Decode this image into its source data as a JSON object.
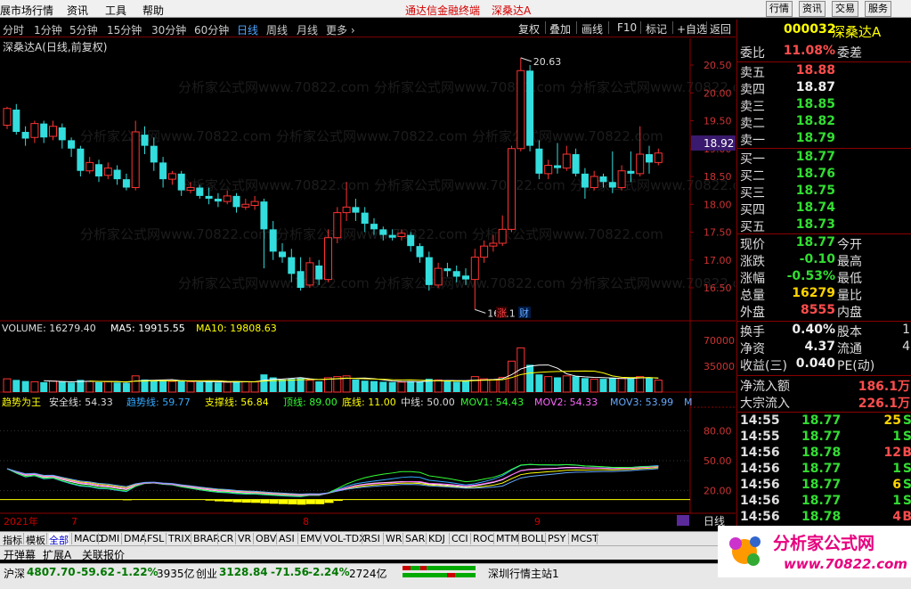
{
  "menubar": {
    "items": [
      "展市场行情",
      "资讯",
      "工具",
      "帮助"
    ],
    "center_text": "通达信金融终端",
    "stock_name": "深桑达A",
    "right_buttons": [
      "行情",
      "资讯",
      "交易",
      "服务"
    ]
  },
  "toolbar": {
    "periods": [
      "分时",
      "1分钟",
      "5分钟",
      "15分钟",
      "30分钟",
      "60分钟",
      "日线",
      "周线",
      "月线",
      "更多 ›"
    ],
    "active_period": "日线",
    "buttons": [
      "复权",
      "叠加",
      "画线",
      "F10",
      "标记",
      "+自选",
      "返回"
    ]
  },
  "chart": {
    "title": "深桑达A(日线,前复权)",
    "watermark": "分析家公式网www.70822.com",
    "y_ticks": [
      "20.50",
      "20.00",
      "19.50",
      "19.00",
      "18.50",
      "18.00",
      "17.50",
      "17.00",
      "16.50"
    ],
    "high_label": "20.63",
    "low_label": "16.11",
    "current_price_tag": "18.92",
    "event_markers": [
      "涨",
      "财"
    ],
    "candles": [
      [
        19.42,
        19.72,
        19.35,
        19.75
      ],
      [
        19.7,
        19.3,
        19.25,
        19.8
      ],
      [
        19.3,
        19.18,
        19.05,
        19.4
      ],
      [
        19.2,
        19.45,
        19.1,
        19.5
      ],
      [
        19.45,
        19.2,
        19.1,
        19.5
      ],
      [
        19.22,
        19.4,
        19.15,
        19.5
      ],
      [
        19.38,
        19.15,
        19.0,
        19.45
      ],
      [
        19.15,
        19.0,
        18.85,
        19.2
      ],
      [
        19.0,
        18.6,
        18.5,
        19.05
      ],
      [
        18.6,
        18.75,
        18.55,
        18.85
      ],
      [
        18.72,
        18.5,
        18.4,
        18.8
      ],
      [
        18.52,
        18.65,
        18.45,
        18.75
      ],
      [
        18.62,
        18.45,
        18.35,
        18.7
      ],
      [
        18.45,
        18.3,
        18.25,
        18.55
      ],
      [
        18.3,
        19.3,
        18.25,
        19.5
      ],
      [
        19.25,
        19.05,
        18.9,
        19.4
      ],
      [
        19.05,
        18.75,
        18.6,
        19.2
      ],
      [
        18.75,
        18.45,
        18.3,
        18.85
      ],
      [
        18.45,
        18.55,
        18.35,
        18.6
      ],
      [
        18.55,
        18.25,
        18.15,
        18.6
      ],
      [
        18.25,
        18.3,
        18.2,
        18.4
      ],
      [
        18.3,
        18.15,
        18.1,
        18.35
      ],
      [
        18.15,
        18.1,
        18.0,
        18.3
      ],
      [
        18.1,
        18.05,
        17.95,
        18.2
      ],
      [
        18.05,
        18.15,
        18.0,
        18.25
      ],
      [
        18.15,
        17.95,
        17.85,
        18.2
      ],
      [
        17.95,
        18.0,
        17.9,
        18.1
      ],
      [
        17.98,
        18.05,
        17.9,
        18.15
      ],
      [
        18.05,
        17.55,
        16.85,
        18.1
      ],
      [
        17.55,
        17.15,
        17.0,
        17.7
      ],
      [
        17.15,
        17.05,
        16.95,
        17.3
      ],
      [
        17.05,
        16.75,
        16.6,
        17.2
      ],
      [
        16.8,
        16.5,
        16.45,
        17.05
      ],
      [
        16.55,
        16.95,
        16.5,
        17.05
      ],
      [
        16.9,
        16.65,
        16.55,
        17.0
      ],
      [
        16.65,
        17.4,
        16.6,
        17.55
      ],
      [
        17.4,
        17.85,
        17.3,
        17.95
      ],
      [
        17.85,
        17.95,
        17.7,
        18.4
      ],
      [
        17.95,
        17.85,
        17.7,
        18.1
      ],
      [
        17.85,
        17.65,
        17.5,
        17.95
      ],
      [
        17.65,
        17.55,
        17.45,
        17.75
      ],
      [
        17.55,
        17.45,
        17.35,
        17.6
      ],
      [
        17.45,
        17.4,
        17.35,
        17.55
      ],
      [
        17.42,
        17.48,
        17.35,
        17.55
      ],
      [
        17.45,
        17.25,
        17.15,
        17.5
      ],
      [
        17.25,
        17.05,
        16.95,
        17.3
      ],
      [
        17.05,
        16.55,
        16.45,
        17.15
      ],
      [
        16.55,
        16.85,
        16.5,
        16.95
      ],
      [
        16.85,
        16.8,
        16.7,
        16.95
      ],
      [
        16.8,
        16.7,
        16.6,
        16.9
      ],
      [
        16.72,
        16.65,
        16.55,
        16.85
      ],
      [
        16.65,
        17.05,
        16.11,
        17.2
      ],
      [
        17.05,
        17.25,
        16.95,
        17.35
      ],
      [
        17.25,
        17.3,
        17.15,
        17.45
      ],
      [
        17.3,
        17.55,
        17.25,
        17.8
      ],
      [
        17.55,
        19.0,
        17.5,
        19.05
      ],
      [
        19.0,
        20.4,
        18.95,
        20.63
      ],
      [
        20.4,
        19.05,
        18.95,
        20.5
      ],
      [
        19.0,
        18.55,
        18.45,
        19.15
      ],
      [
        18.55,
        18.7,
        18.45,
        18.8
      ],
      [
        18.7,
        18.65,
        18.55,
        19.1
      ],
      [
        18.65,
        18.9,
        18.6,
        19.05
      ],
      [
        18.9,
        18.55,
        18.5,
        19.0
      ],
      [
        18.55,
        18.3,
        18.1,
        18.65
      ],
      [
        18.3,
        18.5,
        18.25,
        18.6
      ],
      [
        18.5,
        18.4,
        18.3,
        18.55
      ],
      [
        18.4,
        18.3,
        18.2,
        18.95
      ],
      [
        18.3,
        18.6,
        18.25,
        18.7
      ],
      [
        18.6,
        18.55,
        18.4,
        18.95
      ],
      [
        18.55,
        18.9,
        18.5,
        19.4
      ],
      [
        18.9,
        18.75,
        18.55,
        19.05
      ],
      [
        18.75,
        18.92,
        18.7,
        19.0
      ]
    ],
    "volume_bars": [
      18000,
      16500,
      15000,
      14000,
      13500,
      15000,
      14000,
      13000,
      16500,
      14500,
      13500,
      14000,
      13000,
      12500,
      22000,
      17000,
      16000,
      15000,
      14500,
      15000,
      14000,
      13500,
      14000,
      13000,
      13500,
      15000,
      14000,
      13800,
      24000,
      20000,
      17000,
      18000,
      19000,
      16000,
      14500,
      19500,
      21000,
      22000,
      17000,
      15500,
      15000,
      14000,
      13500,
      13500,
      15000,
      14500,
      18000,
      16500,
      15000,
      14000,
      14500,
      21000,
      18000,
      17000,
      20000,
      42000,
      60000,
      37000,
      24000,
      21000,
      20000,
      22000,
      21500,
      19000,
      17500,
      18000,
      19500,
      18500,
      19000,
      21000,
      20000,
      16279
    ],
    "volume_ticks": [
      "70000",
      "35000"
    ],
    "volume_info": {
      "volume_label": "VOLUME: 16279.40",
      "ma5_label": "MA5: 19915.55",
      "ma10_label": "MA10: 19808.63"
    },
    "indicator_info": {
      "name": "趋势为王",
      "safe": "安全线: 54.33",
      "trend": "趋势线: 59.77",
      "support": "支撑线: 56.84",
      "top": "顶线: 89.00",
      "bottom": "底线: 11.00",
      "mid": "中线: 50.00",
      "mov1": "MOV1: 54.43",
      "mov2": "MOV2: 54.33",
      "mov3": "MOV3: 53.99",
      "more": "M"
    },
    "indicator_ticks": [
      "80.00",
      "50.00",
      "20.00"
    ],
    "date_labels": [
      "2021年",
      "7",
      "8",
      "9"
    ],
    "period_tag": "日线"
  },
  "quote": {
    "code": "000032",
    "name": "深桑达A",
    "weibi_label": "委比",
    "weibi_value": "11.08%",
    "weicha_label": "委差",
    "sell": [
      {
        "label": "卖五",
        "price": "18.88",
        "color": "up"
      },
      {
        "label": "卖四",
        "price": "18.87",
        "color": "wh"
      },
      {
        "label": "卖三",
        "price": "18.85",
        "color": "dn"
      },
      {
        "label": "卖二",
        "price": "18.82",
        "color": "dn"
      },
      {
        "label": "卖一",
        "price": "18.79",
        "color": "dn"
      }
    ],
    "buy": [
      {
        "label": "买一",
        "price": "18.77",
        "color": "dn"
      },
      {
        "label": "买二",
        "price": "18.76",
        "color": "dn"
      },
      {
        "label": "买三",
        "price": "18.75",
        "color": "dn"
      },
      {
        "label": "买四",
        "price": "18.74",
        "color": "dn"
      },
      {
        "label": "买五",
        "price": "18.73",
        "color": "dn"
      }
    ],
    "stats": [
      {
        "label": "现价",
        "value": "18.77",
        "color": "dn",
        "label2": "今开"
      },
      {
        "label": "涨跌",
        "value": "-0.10",
        "color": "dn",
        "label2": "最高"
      },
      {
        "label": "涨幅",
        "value": "-0.53%",
        "color": "dn",
        "label2": "最低"
      },
      {
        "label": "总量",
        "value": "16279",
        "color": "yl",
        "label2": "量比"
      },
      {
        "label": "外盘",
        "value": "8555",
        "color": "up",
        "label2": "内盘"
      }
    ],
    "stats2": [
      {
        "label": "换手",
        "value": "0.40%",
        "label2": "股本",
        "value2": "1"
      },
      {
        "label": "净资",
        "value": "4.37",
        "label2": "流通",
        "value2": "4"
      },
      {
        "label": "收益(三)",
        "value": "0.040",
        "label2": "PE(动)",
        "value2": ""
      }
    ],
    "netflow_label": "净流入额",
    "netflow_value": "186.1万",
    "bigflow_label": "大宗流入",
    "bigflow_value": "226.1万",
    "ticks": [
      {
        "time": "14:55",
        "price": "18.77",
        "vol": "25",
        "dir": "S",
        "pc": "dn",
        "vc": "yl"
      },
      {
        "time": "14:55",
        "price": "18.77",
        "vol": "1",
        "dir": "S",
        "pc": "dn",
        "vc": "dn"
      },
      {
        "time": "14:56",
        "price": "18.78",
        "vol": "12",
        "dir": "B",
        "pc": "dn",
        "vc": "up"
      },
      {
        "time": "14:56",
        "price": "18.77",
        "vol": "1",
        "dir": "S",
        "pc": "dn",
        "vc": "dn"
      },
      {
        "time": "14:56",
        "price": "18.77",
        "vol": "6",
        "dir": "S",
        "pc": "dn",
        "vc": "yl"
      },
      {
        "time": "14:56",
        "price": "18.77",
        "vol": "1",
        "dir": "S",
        "pc": "dn",
        "vc": "dn"
      },
      {
        "time": "14:56",
        "price": "18.78",
        "vol": "4",
        "dir": "B",
        "pc": "dn",
        "vc": "up"
      }
    ]
  },
  "tabs": [
    "指标",
    "模板",
    "全部",
    "MACD",
    "DMI",
    "DMA",
    "FSL",
    "TRIX",
    "BRAR",
    "CR",
    "VR",
    "OBV",
    "ASI",
    "EMV",
    "VOL-TDX",
    "RSI",
    "WR",
    "SAR",
    "KDJ",
    "CCI",
    "ROC",
    "MTM",
    "BOLL",
    "PSY",
    "MCST"
  ],
  "active_tab": "全部",
  "bar2": [
    "开弹幕",
    "扩展A",
    "关联报价"
  ],
  "status": {
    "sh_label": "沪深",
    "sh_index": "4807.70",
    "sh_change": "-59.62",
    "sh_pct": "-1.22%",
    "sh_amount": "3935亿",
    "cy_label": "创业",
    "cy_index": "3128.84",
    "cy_change": "-71.56",
    "cy_pct": "-2.24%",
    "cy_amount": "2724亿",
    "server": "深圳行情主站1"
  },
  "logo": {
    "name": "分析家公式网",
    "url": "www.70822.com"
  },
  "colors": {
    "up": "#ff3333",
    "down": "#33dddd",
    "axis_red": "#8b0000",
    "ma5": "#ffffff",
    "ma10": "#ffff00"
  }
}
